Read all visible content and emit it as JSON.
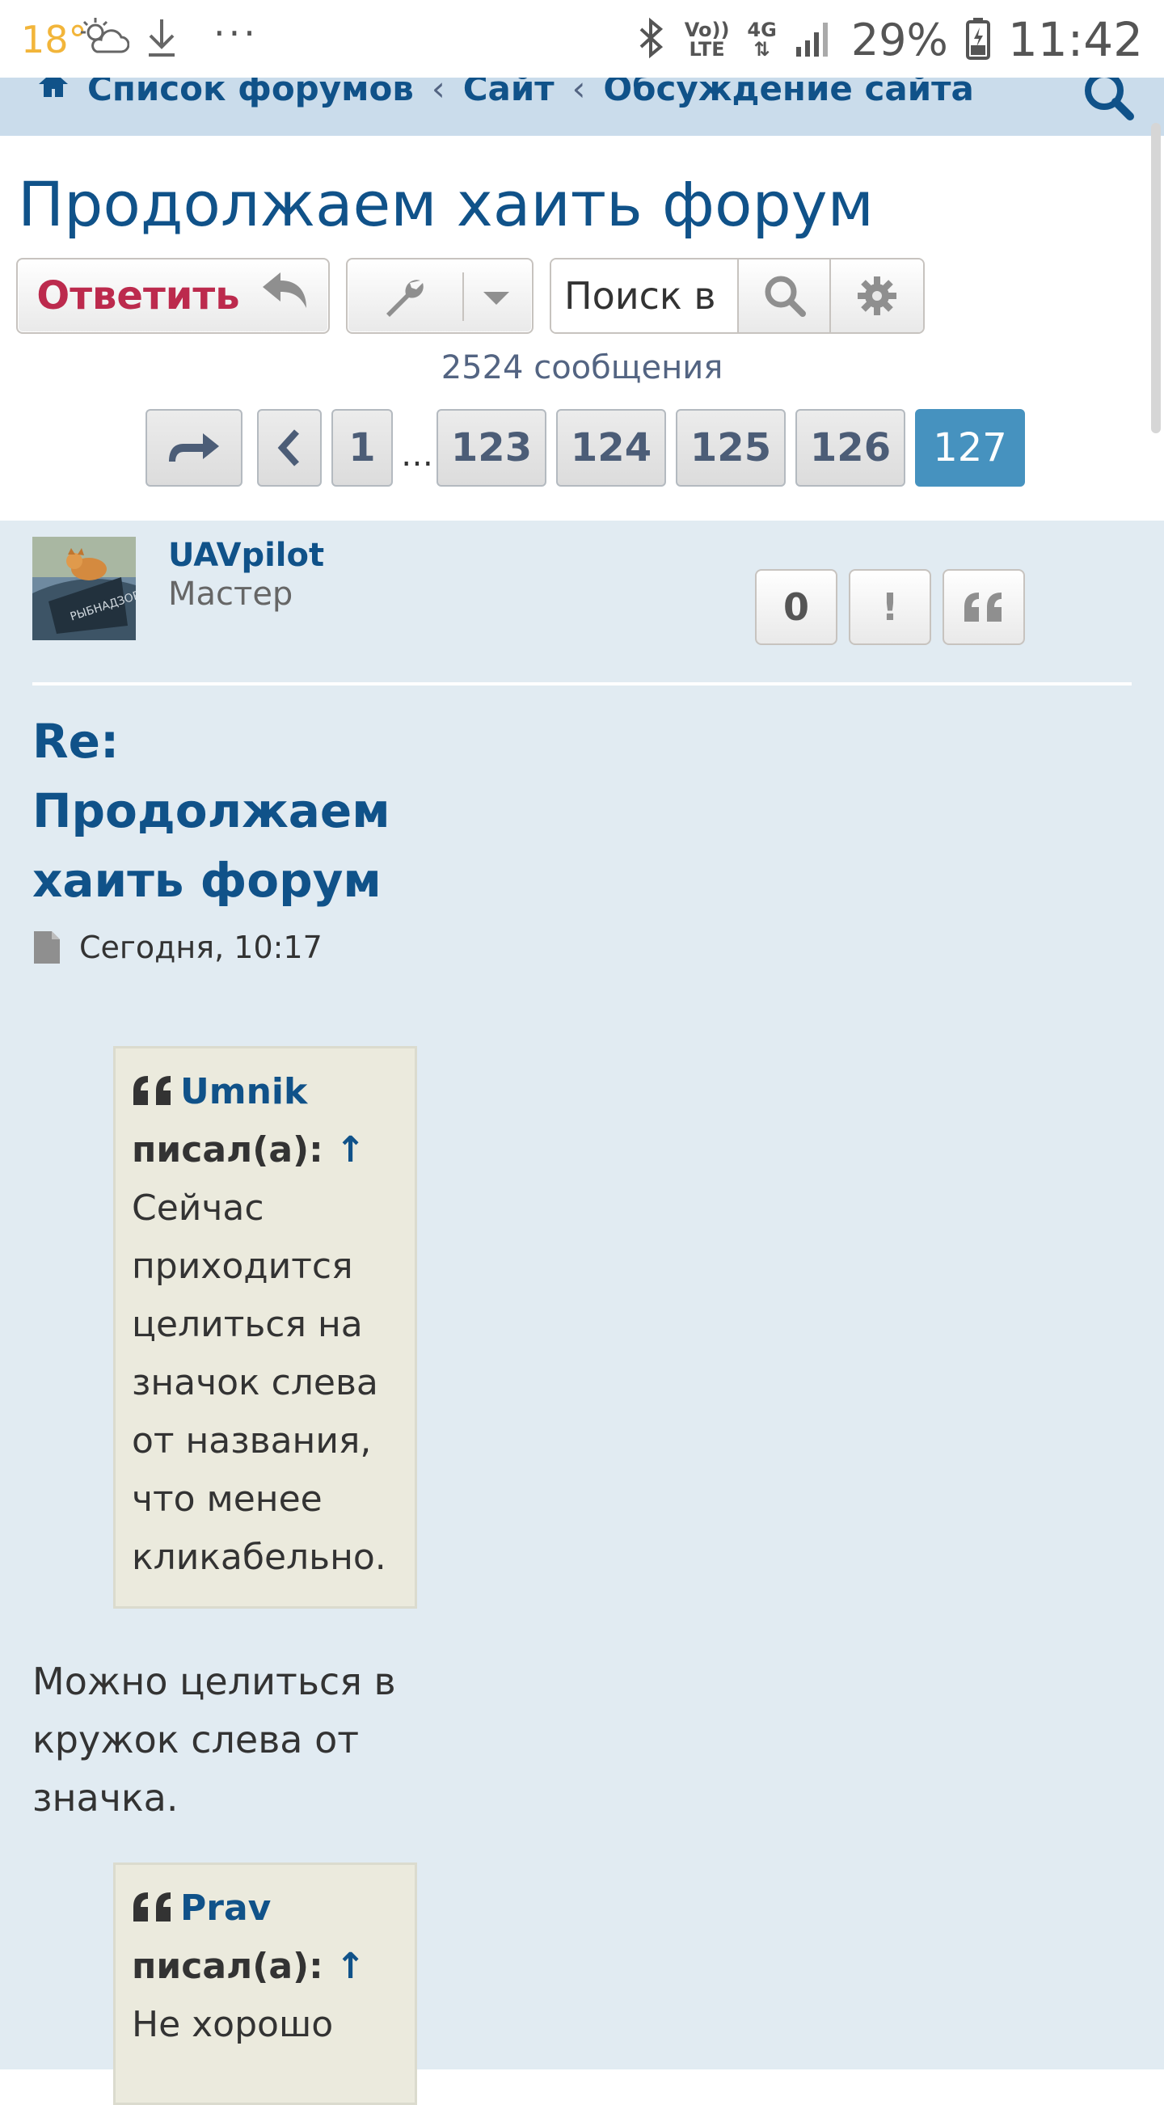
{
  "statusbar": {
    "temperature": "18°",
    "weather_icon": "cloudy-sun-icon",
    "download_icon": "download-icon",
    "more": "···",
    "volte_top": "Vo))",
    "volte_bottom": "LTE",
    "network_top": "4G",
    "network_bottom": "⇅",
    "battery_percent": "29%",
    "time": "11:42"
  },
  "breadcrumb": {
    "items": [
      "Список форумов",
      "Сайт",
      "Обсуждение сайта"
    ],
    "separator": "‹"
  },
  "topic": {
    "title": "Продолжаем хаить форум",
    "reply_label": "Ответить",
    "search_placeholder": "Поиск в",
    "post_count": "2524 сообщения"
  },
  "pagination": {
    "pages": [
      "1",
      "123",
      "124",
      "125",
      "126",
      "127"
    ],
    "ellipsis": "…",
    "current": "127"
  },
  "post": {
    "author": "UAVpilot",
    "rank": "Мастер",
    "actions": {
      "reactions": "0",
      "report": "!",
      "quote": "❝"
    },
    "title_line1": "Re:",
    "title_line2": "Продолжаем",
    "title_line3": "хаить форум",
    "date": "Сегодня, 10:17",
    "quotes": [
      {
        "author": "Umnik",
        "wrote": "писал(а):",
        "arrow": "↑",
        "lines": [
          "Сейчас",
          "приходится",
          "целиться на",
          "значок слева",
          "от названия,",
          "что менее",
          "кликабельно."
        ]
      },
      {
        "author": "Prav",
        "wrote": "писал(а):",
        "arrow": "↑",
        "lines": [
          "Не хорошо"
        ]
      }
    ],
    "reply_lines": [
      "Можно целиться в",
      "кружок слева от",
      "значка."
    ]
  },
  "colors": {
    "link": "#105289",
    "reply_accent": "#bc2a4d",
    "active_page": "#4692bf",
    "post_bg": "#e1ebf2",
    "header_bg": "#cadceb",
    "quote_bg": "#ebeadd"
  }
}
